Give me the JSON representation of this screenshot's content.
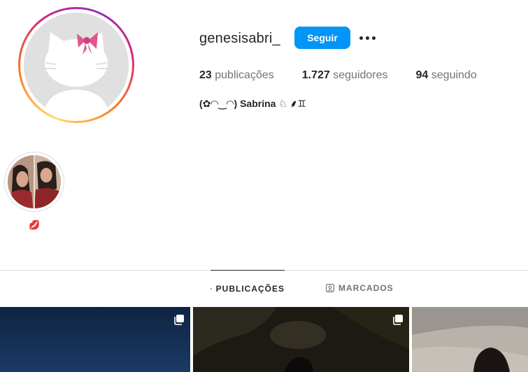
{
  "profile": {
    "username": "genesisabri_",
    "follow_label": "Seguir",
    "bio": "(✿◠‿◠) Sabrina ♘ ⸙♊"
  },
  "stats": {
    "posts_count": "23",
    "posts_label": "publicações",
    "followers_count": "1.727",
    "followers_label": "seguidores",
    "following_count": "94",
    "following_label": "seguindo"
  },
  "highlights": [
    {
      "label": "💋"
    }
  ],
  "tabs": {
    "posts_label": "PUBLICAÇÕES",
    "tagged_label": "MARCADOS"
  },
  "colors": {
    "accent": "#0095f6",
    "text": "#262626",
    "muted": "#737373",
    "divider": "#dbdbdb"
  },
  "icons": {
    "more": "more-horizontal-icon",
    "grid": "grid-icon",
    "tagged": "tagged-icon",
    "multi": "multiple-posts-icon"
  }
}
